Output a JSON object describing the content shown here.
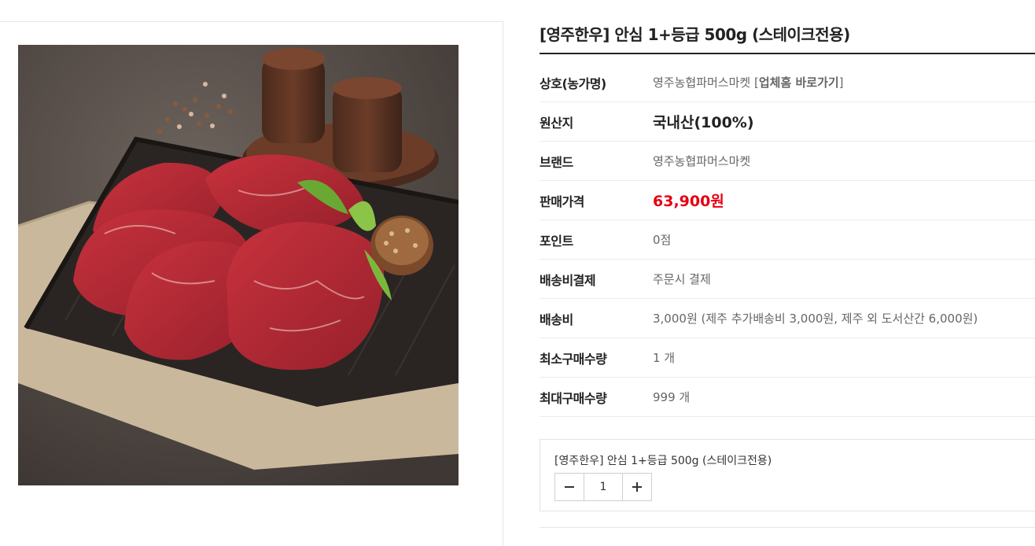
{
  "product": {
    "title": "[영주한우] 안심 1+등급 500g (스테이크전용)",
    "image_alt": "영주한우 안심 스테이크"
  },
  "info": {
    "shop": {
      "label": "상호(농가명)",
      "name": "영주농협파머스마켓",
      "link_open": "[",
      "link_text": "업체홈 바로가기",
      "link_close": "]"
    },
    "origin": {
      "label": "원산지",
      "value": "국내산(100%)"
    },
    "brand": {
      "label": "브랜드",
      "value": "영주농협파머스마켓"
    },
    "price": {
      "label": "판매가격",
      "value": "63,900원"
    },
    "point": {
      "label": "포인트",
      "value": "0점"
    },
    "shipping_payment": {
      "label": "배송비결제",
      "value": "주문시 결제"
    },
    "shipping_fee": {
      "label": "배송비",
      "value": "3,000원 (제주 추가배송비 3,000원, 제주 외 도서산간 6,000원)"
    },
    "min_qty": {
      "label": "최소구매수량",
      "value": "1 개"
    },
    "max_qty": {
      "label": "최대구매수량",
      "value": "999 개"
    }
  },
  "option": {
    "name": "[영주한우] 안심 1+등급 500g (스테이크전용)",
    "quantity": "1",
    "minus_icon": "minus-icon",
    "plus_icon": "plus-icon"
  },
  "colors": {
    "price": "#e60012",
    "title_rule": "#222222"
  }
}
